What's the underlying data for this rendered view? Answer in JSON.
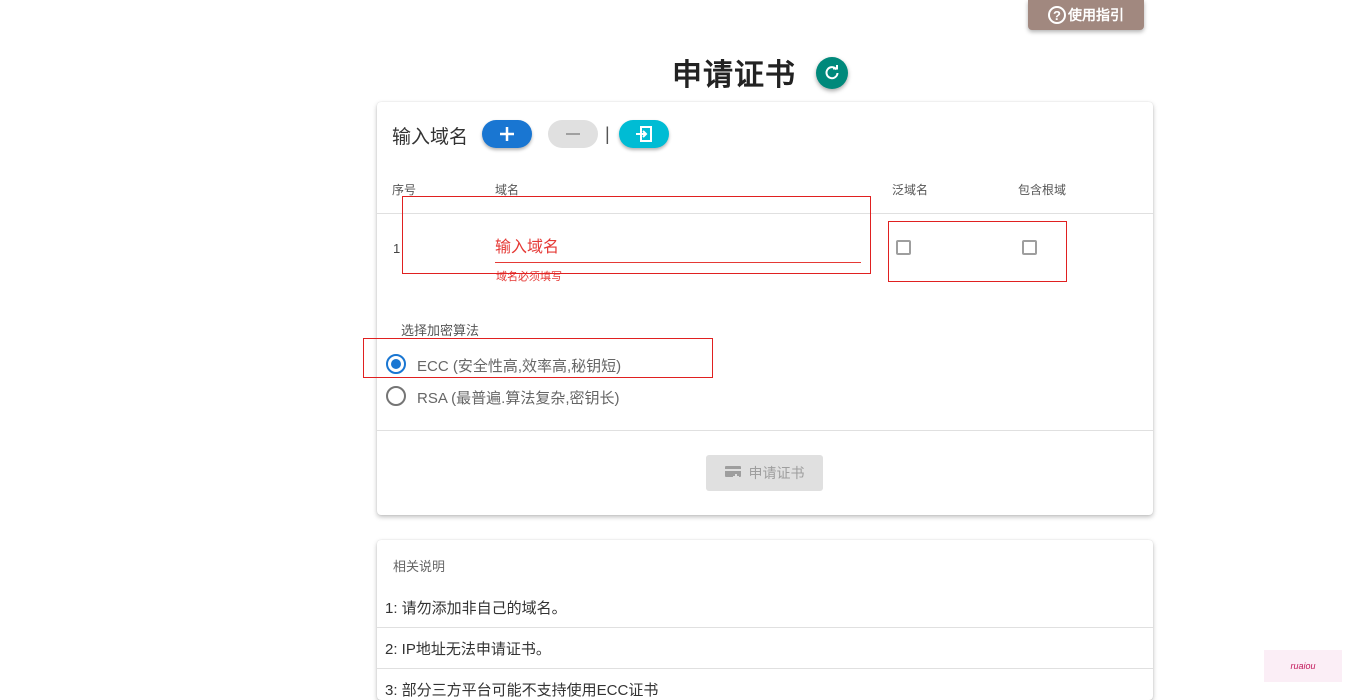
{
  "header": {
    "guide_label": "使用指引",
    "guide_icon": "help-circle-icon",
    "title": "申请证书",
    "refresh_icon": "refresh-icon"
  },
  "form": {
    "label": "输入域名",
    "add_icon": "plus-icon",
    "remove_icon": "minus-icon",
    "separator": "|",
    "import_icon": "import-icon",
    "columns": {
      "index": "序号",
      "domain": "域名",
      "wildcard": "泛域名",
      "root": "包含根域"
    },
    "rows": [
      {
        "index": "1",
        "domain_value": "",
        "domain_placeholder": "输入域名",
        "error": "域名必须填写",
        "wildcard": false,
        "root": false
      }
    ],
    "algorithm": {
      "label": "选择加密算法",
      "options": [
        {
          "label": "ECC (安全性高,效率高,秘钥短)",
          "selected": true
        },
        {
          "label": "RSA (最普遍.算法复杂,密钥长)",
          "selected": false
        }
      ]
    },
    "submit_label": "申请证书",
    "submit_icon": "certificate-add-icon"
  },
  "info": {
    "title": "相关说明",
    "items": [
      "1: 请勿添加非自己的域名。",
      "2: IP地址无法申请证书。",
      "3: 部分三方平台可能不支持使用ECC证书"
    ]
  },
  "watermark": "ruaiou",
  "colors": {
    "guide": "#a1887f",
    "refresh": "#00897b",
    "add": "#1976d2",
    "remove": "#e0e0e0",
    "import": "#00bcd4",
    "error": "#e53935",
    "highlight": "#e02020"
  }
}
